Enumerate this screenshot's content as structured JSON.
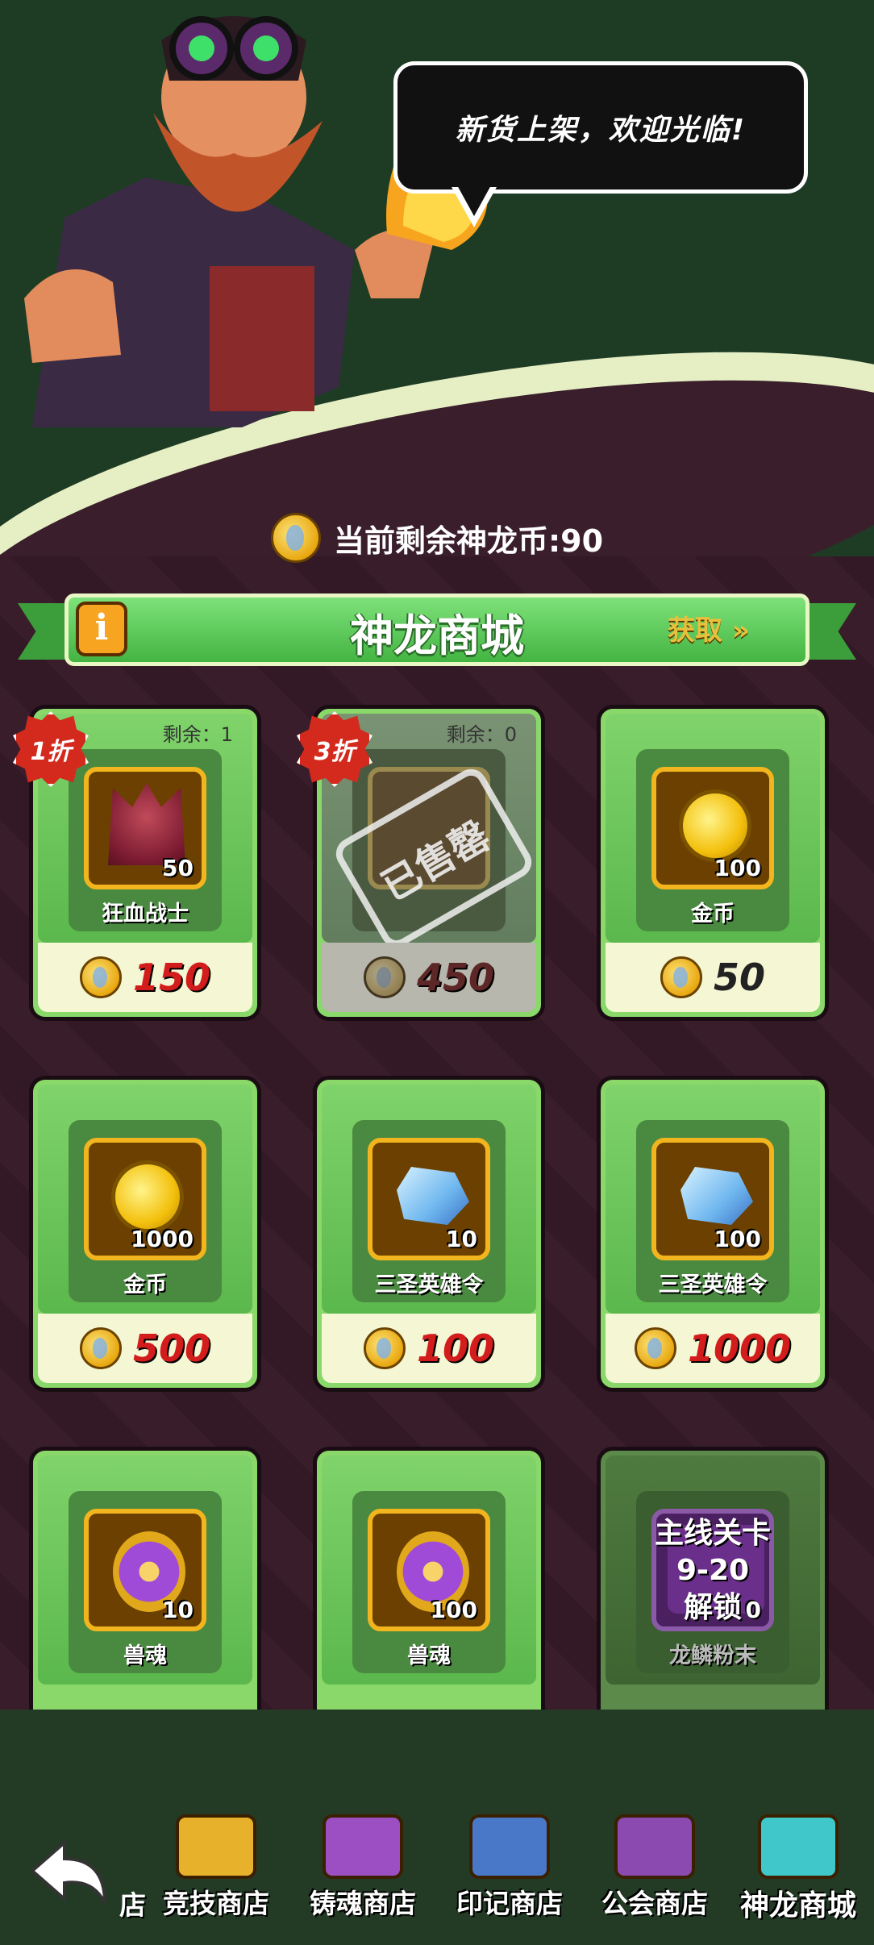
{
  "speech": "新货上架，欢迎光临!",
  "balance_text": "当前剩余神龙币:90",
  "banner": {
    "title": "神龙商城",
    "info": "i",
    "get_label": "获取 »"
  },
  "items": [
    {
      "name": "狂血战士",
      "qty": "50",
      "price": "150",
      "discount": "1折",
      "remain": "剩余：1",
      "icon": "warrior-icon"
    },
    {
      "name": "",
      "qty": "",
      "price": "450",
      "discount": "3折",
      "remain": "剩余：0",
      "soldout": "已售罄",
      "icon": "sold-out-item"
    },
    {
      "name": "金币",
      "qty": "100",
      "price": "50",
      "icon": "gold-coin-icon"
    },
    {
      "name": "金币",
      "qty": "1000",
      "price": "500",
      "icon": "gold-coin-icon"
    },
    {
      "name": "三圣英雄令",
      "qty": "10",
      "price": "100",
      "icon": "crystal-icon"
    },
    {
      "name": "三圣英雄令",
      "qty": "100",
      "price": "1000",
      "icon": "crystal-icon"
    },
    {
      "name": "兽魂",
      "qty": "10",
      "icon": "beast-soul-icon"
    },
    {
      "name": "兽魂",
      "qty": "100",
      "icon": "beast-soul-icon"
    },
    {
      "name": "龙鳞粉末",
      "qty": "0",
      "lock_line1": "主线关卡",
      "lock_line2": "9-20",
      "lock_line3": "解锁",
      "icon": "dragon-scale-icon"
    }
  ],
  "nav": {
    "back": "back-arrow-icon",
    "partial": "店",
    "tabs": [
      "竞技商店",
      "铸魂商店",
      "印记商店",
      "公会商店",
      "神龙商城"
    ],
    "active": "神龙商城"
  },
  "colors": {
    "price_red": "#d31c1c",
    "card_green": "#8ad86a",
    "banner_green": "#43b442"
  }
}
